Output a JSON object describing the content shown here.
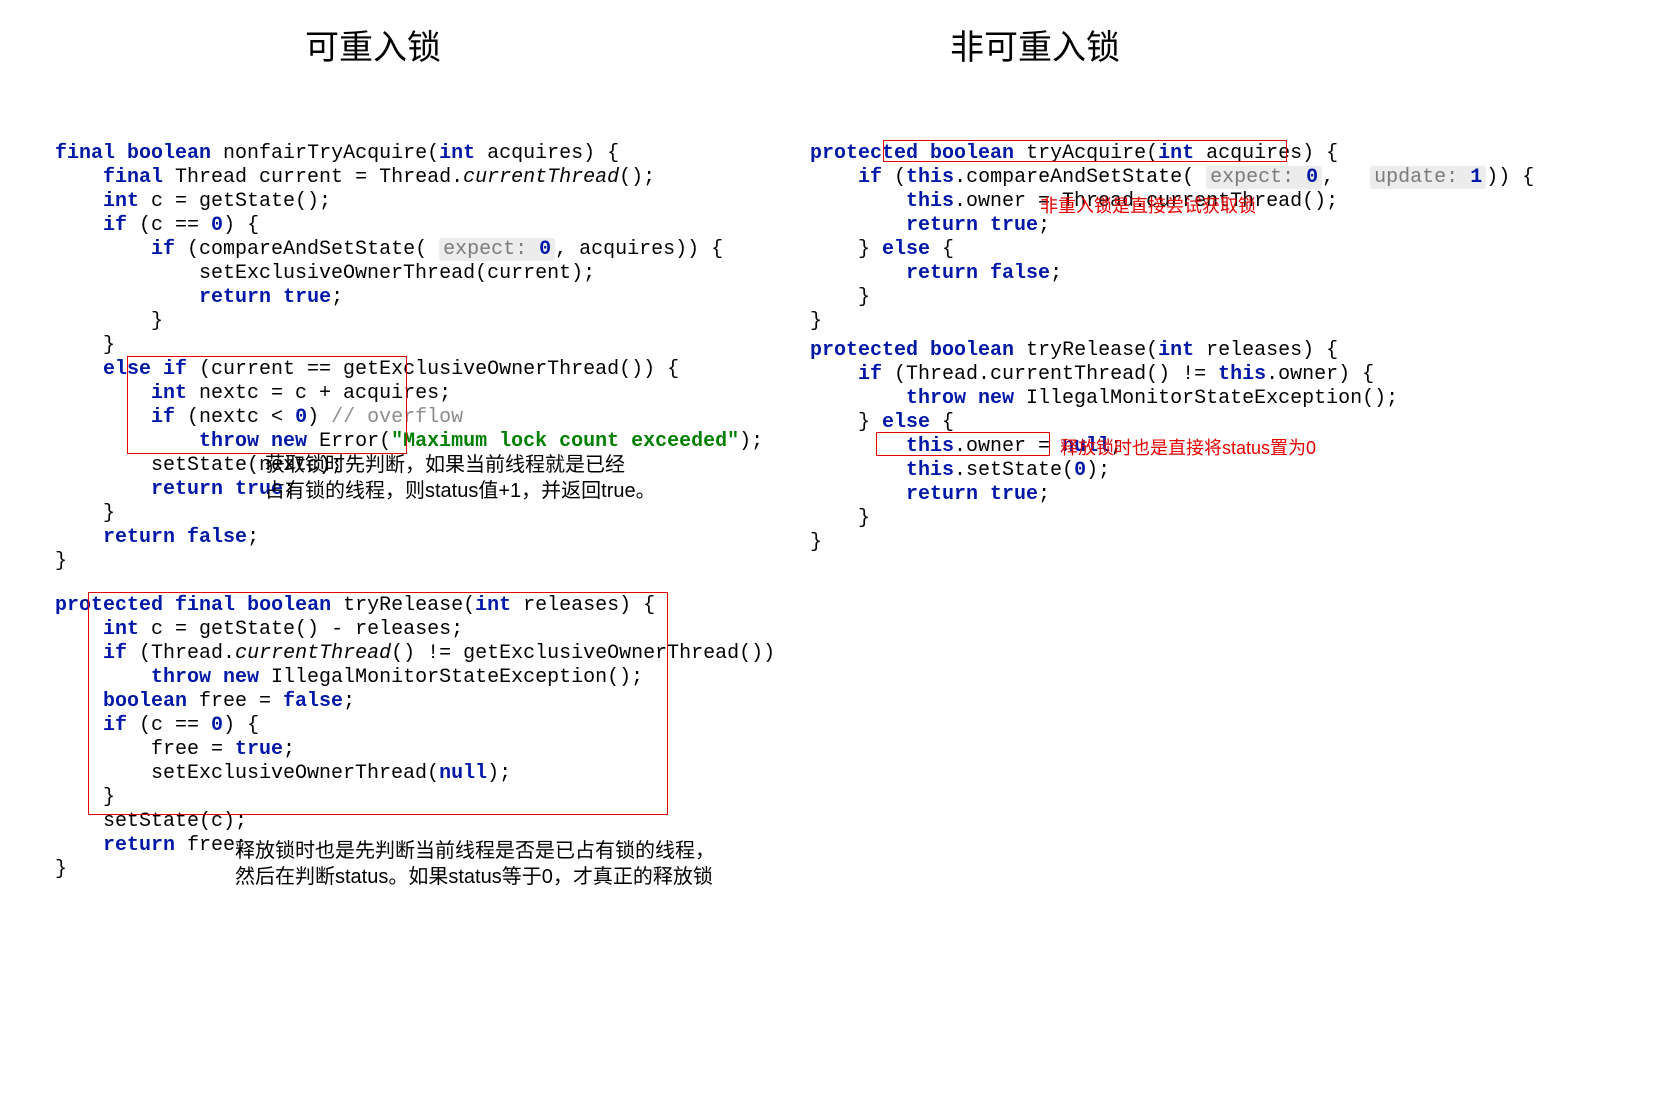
{
  "titles": {
    "left": "可重入锁",
    "right": "非可重入锁"
  },
  "leftAcquire": {
    "l1a": "final",
    "l1b": "boolean",
    "l1c": " nonfairTryAcquire(",
    "l1d": "int",
    "l1e": " acquires) {",
    "l2a": "final",
    "l2b": " Thread current = Thread.",
    "l2c": "currentThread",
    "l2d": "();",
    "l3a": "int",
    "l3b": " c = getState();",
    "l4a": "if",
    "l4b": " (c == ",
    "l4c": "0",
    "l4d": ") {",
    "l5a": "if",
    "l5b": " (compareAndSetState( ",
    "l5h": "expect:",
    "l5hv": "0",
    "l5c": ", acquires)) {",
    "l6": "            setExclusiveOwnerThread(current);",
    "l7a": "return",
    "l7b": "true",
    "l7c": ";",
    "l8": "        }",
    "l9": "    }",
    "l10a": "else if",
    "l10b": " (current == getExclusiveOwnerThread()) {",
    "l11a": "int",
    "l11b": " nextc = c + acquires;",
    "l12a": "if",
    "l12b": " (nextc < ",
    "l12c": "0",
    "l12d": ") ",
    "l12e": "// overflow",
    "l13a": "throw new",
    "l13b": " Error(",
    "l13c": "\"Maximum lock count exceeded\"",
    "l13d": ");",
    "l14": "        setState(nextc);",
    "l15a": "return",
    "l15b": "true",
    "l15c": ";",
    "l16": "    }",
    "l17a": "return",
    "l17b": "false",
    "l17c": ";",
    "l18": "}"
  },
  "leftRelease": {
    "l1a": "protected",
    "l1b": "final",
    "l1c": "boolean",
    "l1d": " tryRelease(",
    "l1e": "int",
    "l1f": " releases) {",
    "l2a": "int",
    "l2b": " c = getState() - releases;",
    "l3a": "if",
    "l3b": " (Thread.",
    "l3c": "currentThread",
    "l3d": "() != getExclusiveOwnerThread())",
    "l4a": "throw new",
    "l4b": " IllegalMonitorStateException();",
    "l5a": "boolean",
    "l5b": " free = ",
    "l5c": "false",
    "l5d": ";",
    "l6a": "if",
    "l6b": " (c == ",
    "l6c": "0",
    "l6d": ") {",
    "l7a": "        free = ",
    "l7b": "true",
    "l7c": ";",
    "l8a": "        setExclusiveOwnerThread(",
    "l8b": "null",
    "l8c": ");",
    "l9": "    }",
    "l10": "    setState(c);",
    "l11a": "return",
    "l11b": " free;",
    "l12": "}"
  },
  "rightAcquire": {
    "l1a": "protected",
    "l1b": "boolean",
    "l1c": " tryAcquire(",
    "l1d": "int",
    "l1e": " acquires) {",
    "l2a": "if",
    "l2b": " (",
    "l2c": "this",
    "l2d": ".compareAndSetState( ",
    "l2h1": "expect:",
    "l2hv1": "0",
    "l2sep": ",   ",
    "l2h2": "update:",
    "l2hv2": "1",
    "l2e": ")) {",
    "l3a": "this",
    "l3b": ".owner = Thread.currentThread();",
    "l4a": "return",
    "l4b": "true",
    "l4c": ";",
    "l5": "    } ",
    "l5a": "else",
    "l5b": " {",
    "l6a": "return",
    "l6b": "false",
    "l6c": ";",
    "l7": "    }",
    "l8": "}"
  },
  "rightRelease": {
    "l1a": "protected",
    "l1b": "boolean",
    "l1c": " tryRelease(",
    "l1d": "int",
    "l1e": " releases) {",
    "l2a": "if",
    "l2b": " (Thread.currentThread() != ",
    "l2c": "this",
    "l2d": ".owner) {",
    "l3a": "throw new",
    "l3b": " IllegalMonitorStateException();",
    "l4": "    } ",
    "l4a": "else",
    "l4b": " {",
    "l5a": "this",
    "l5b": ".owner = ",
    "l5c": "null",
    "l5d": ";",
    "l6a": "this",
    "l6b": ".setState(",
    "l6c": "0",
    "l6d": ");",
    "l7a": "return",
    "l7b": "true",
    "l7c": ";",
    "l8": "    }",
    "l9": "}"
  },
  "annotations": {
    "leftAcq1": "获取锁时先判断，如果当前线程就是已经",
    "leftAcq2": "占有锁的线程，则status值+1，并返回true。",
    "leftRel1": "释放锁时也是先判断当前线程是否是已占有锁的线程，",
    "leftRel2": "然后在判断status。如果status等于0，才真正的释放锁",
    "rightAcq": "非重入锁是直接尝试获取锁",
    "rightRel": "释放锁时也是直接将status置为0"
  }
}
